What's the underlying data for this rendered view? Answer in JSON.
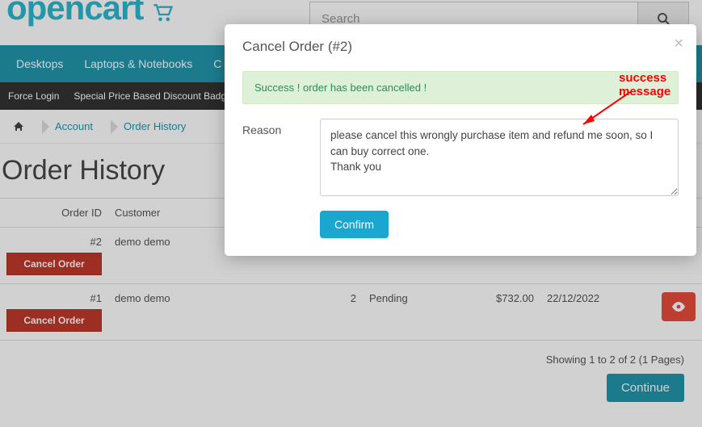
{
  "header": {
    "logo_text": "opencart",
    "search_placeholder": "Search"
  },
  "nav_primary": [
    "Desktops",
    "Laptops & Notebooks",
    "C"
  ],
  "nav_secondary": [
    "Force Login",
    "Special Price Based Discount Badge"
  ],
  "breadcrumb": {
    "items": [
      "Account",
      "Order History"
    ]
  },
  "page_title": "Order History",
  "table": {
    "headers": {
      "order_id": "Order ID",
      "customer": "Customer",
      "qty": "",
      "status": "",
      "total": "",
      "date": "",
      "action": ""
    },
    "rows": [
      {
        "order_id": "#2",
        "customer": "demo demo",
        "qty": "",
        "status": "",
        "total": "",
        "date": "",
        "cancel_label": "Cancel Order",
        "show_eye": false
      },
      {
        "order_id": "#1",
        "customer": "demo demo",
        "qty": "2",
        "status": "Pending",
        "total": "$732.00",
        "date": "22/12/2022",
        "cancel_label": "Cancel Order",
        "show_eye": true
      }
    ]
  },
  "pager_text": "Showing 1 to 2 of 2 (1 Pages)",
  "continue_label": "Continue",
  "modal": {
    "title": "Cancel Order (#2)",
    "success": "Success ! order has been cancelled !",
    "reason_label": "Reason",
    "reason_value": "please cancel this wrongly purchase item and refund me soon, so I can buy correct one.\nThank you",
    "confirm_label": "Confirm"
  },
  "annotation": {
    "text": "success message"
  }
}
